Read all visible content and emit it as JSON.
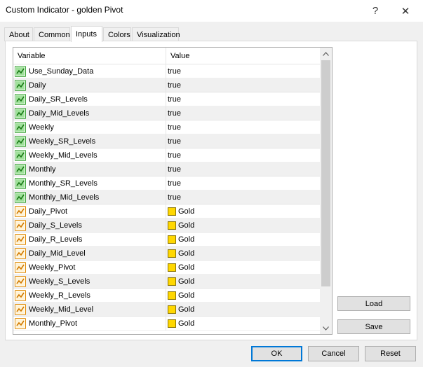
{
  "window": {
    "title": "Custom Indicator - golden Pivot",
    "help_glyph": "?",
    "close_glyph": "✕"
  },
  "tabs": [
    {
      "label": "About",
      "active": false
    },
    {
      "label": "Common",
      "active": false
    },
    {
      "label": "Inputs",
      "active": true
    },
    {
      "label": "Colors",
      "active": false
    },
    {
      "label": "Visualization",
      "active": false
    }
  ],
  "grid": {
    "columns": [
      "Variable",
      "Value"
    ],
    "rows": [
      {
        "variable": "Use_Sunday_Data",
        "value": "true",
        "kind": "bool"
      },
      {
        "variable": "Daily",
        "value": "true",
        "kind": "bool"
      },
      {
        "variable": "Daily_SR_Levels",
        "value": "true",
        "kind": "bool"
      },
      {
        "variable": "Daily_Mid_Levels",
        "value": "true",
        "kind": "bool"
      },
      {
        "variable": "Weekly",
        "value": "true",
        "kind": "bool"
      },
      {
        "variable": "Weekly_SR_Levels",
        "value": "true",
        "kind": "bool"
      },
      {
        "variable": "Weekly_Mid_Levels",
        "value": "true",
        "kind": "bool"
      },
      {
        "variable": "Monthly",
        "value": "true",
        "kind": "bool"
      },
      {
        "variable": "Monthly_SR_Levels",
        "value": "true",
        "kind": "bool"
      },
      {
        "variable": "Monthly_Mid_Levels",
        "value": "true",
        "kind": "bool"
      },
      {
        "variable": "Daily_Pivot",
        "value": "Gold",
        "kind": "color"
      },
      {
        "variable": "Daily_S_Levels",
        "value": "Gold",
        "kind": "color"
      },
      {
        "variable": "Daily_R_Levels",
        "value": "Gold",
        "kind": "color"
      },
      {
        "variable": "Daily_Mid_Level",
        "value": "Gold",
        "kind": "color"
      },
      {
        "variable": "Weekly_Pivot",
        "value": "Gold",
        "kind": "color"
      },
      {
        "variable": "Weekly_S_Levels",
        "value": "Gold",
        "kind": "color"
      },
      {
        "variable": "Weekly_R_Levels",
        "value": "Gold",
        "kind": "color"
      },
      {
        "variable": "Weekly_Mid_Level",
        "value": "Gold",
        "kind": "color"
      },
      {
        "variable": "Monthly_Pivot",
        "value": "Gold",
        "kind": "color"
      }
    ]
  },
  "icons": {
    "bool": "bool-param-icon",
    "color": "color-param-icon"
  },
  "colors": {
    "gold": "#FFD700",
    "bool_icon_green": "#3aa335",
    "color_icon_orange": "#e08a00"
  },
  "buttons": {
    "load": "Load",
    "save": "Save",
    "ok": "OK",
    "cancel": "Cancel",
    "reset": "Reset"
  }
}
